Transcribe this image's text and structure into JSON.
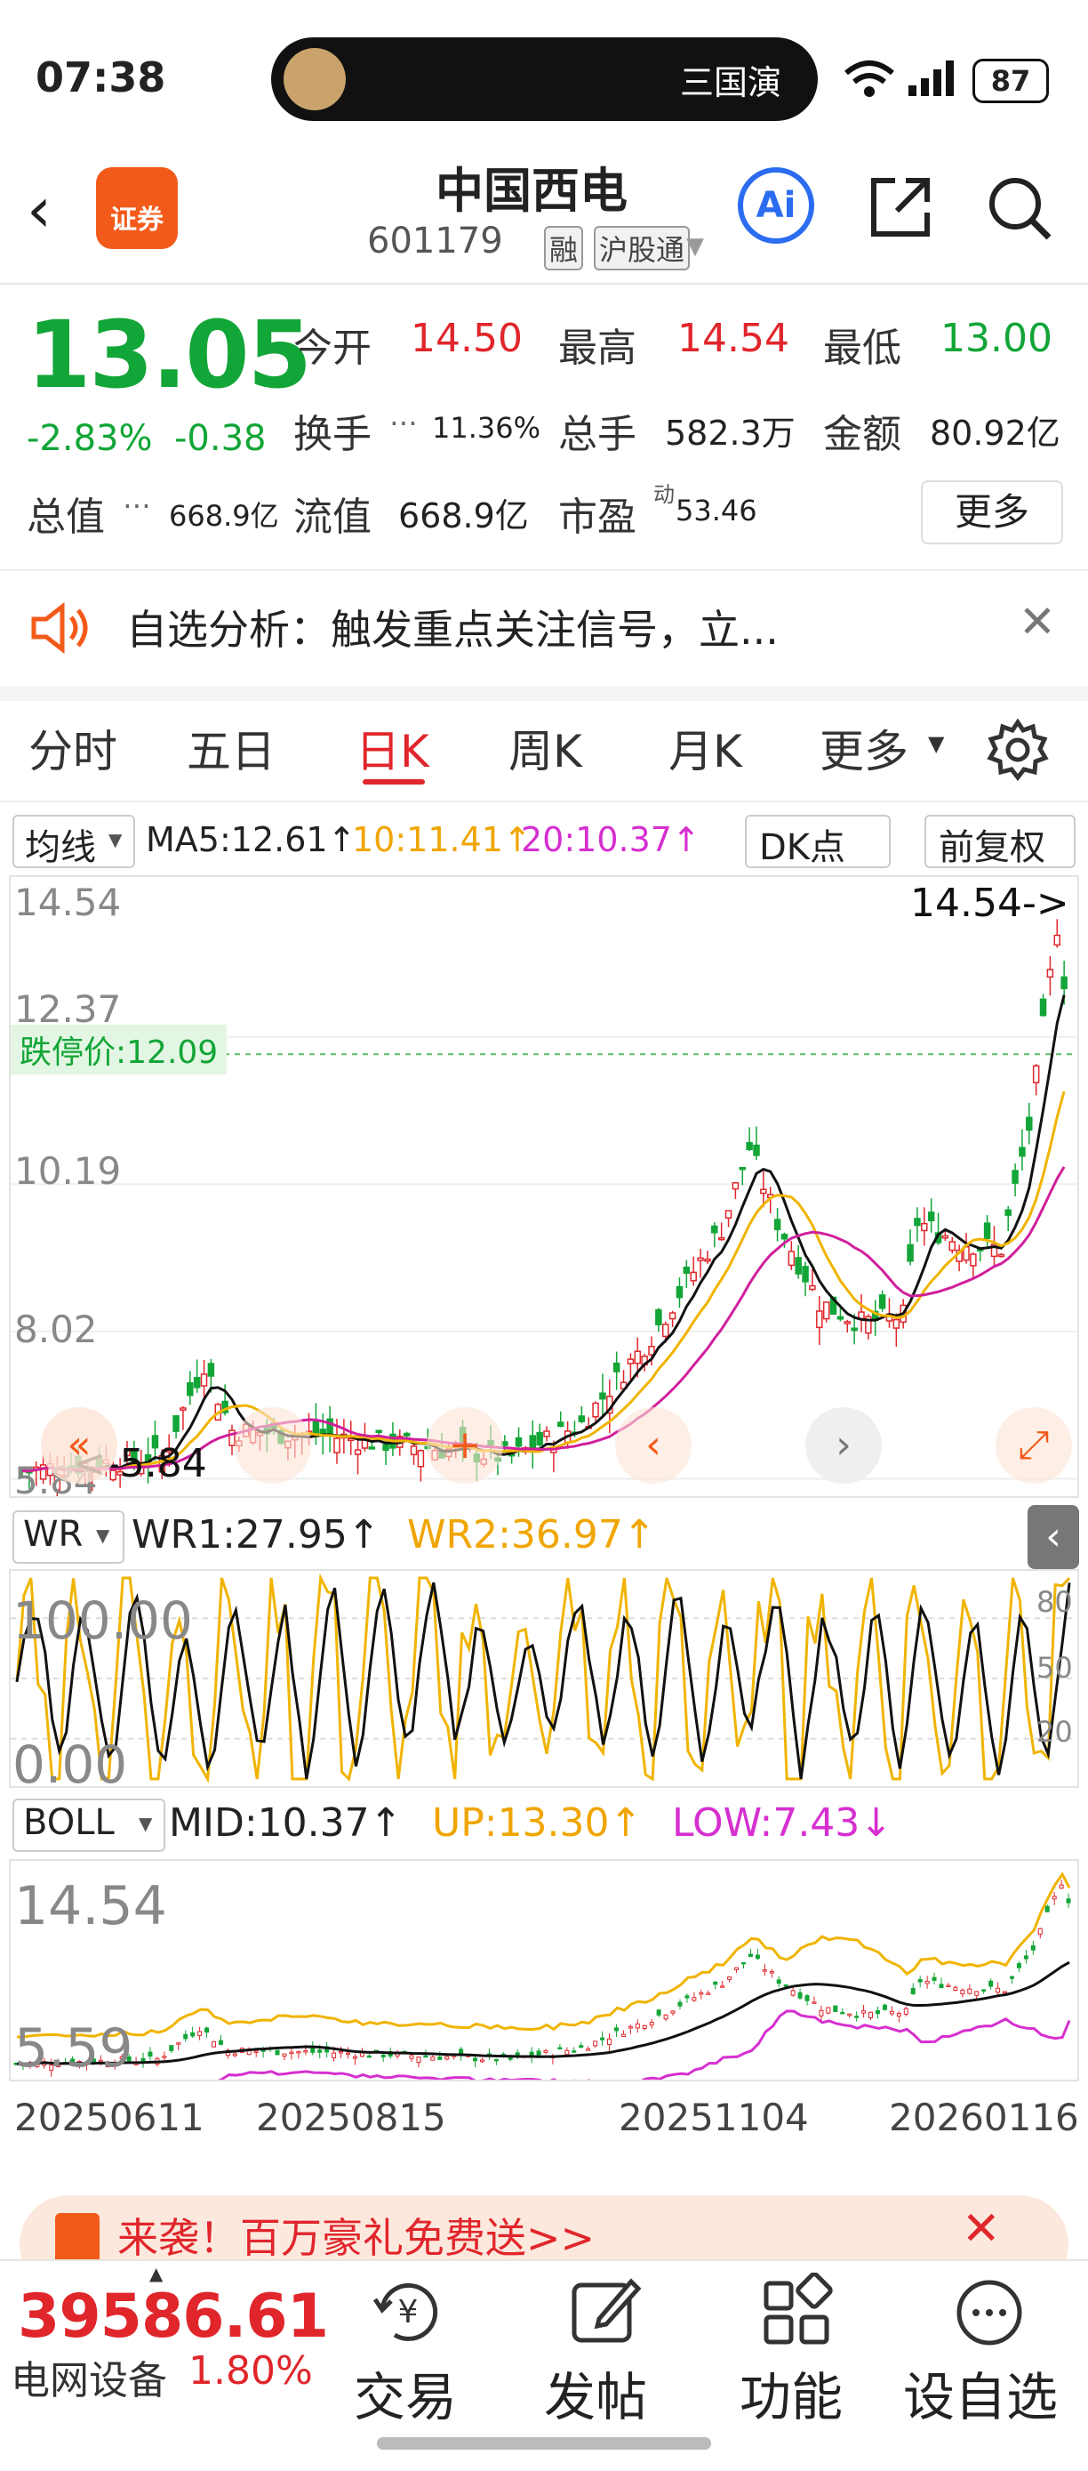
{
  "status_bar": {
    "time": "07:38",
    "island_text": "三国演",
    "battery": "87"
  },
  "header": {
    "logo_text": "证券",
    "stock_name": "中国西电",
    "stock_code": "601179",
    "tag_margin": "融",
    "tag_market": "沪股通",
    "ai_label": "Ai"
  },
  "quote": {
    "price": "13.05",
    "change_pct": "-2.83%",
    "change": "-0.38",
    "open_label": "今开",
    "open": "14.50",
    "high_label": "最高",
    "high": "14.54",
    "low_label": "最低",
    "low": "13.00",
    "turnover_label": "换手",
    "turnover": "11.36%",
    "volume_label": "总手",
    "volume": "582.3万",
    "amount_label": "金额",
    "amount": "80.92亿",
    "mktcap_label": "总值",
    "mktcap": "668.9亿",
    "float_label": "流值",
    "float": "668.9亿",
    "pe_label": "市盈",
    "pe_sup": "动",
    "pe": "53.46",
    "more_label": "更多"
  },
  "alert": {
    "text": "自选分析：触发重点关注信号，立..."
  },
  "tabs": [
    "分时",
    "五日",
    "日K",
    "周K",
    "月K",
    "更多"
  ],
  "active_tab": "日K",
  "indicators": {
    "ma_select": "均线",
    "ma5": "MA5:12.61↑",
    "ma10": "10:11.41↑",
    "ma20": "20:10.37↑",
    "dk_label": "DK点",
    "adjust_label": "前复权"
  },
  "kline": {
    "y_labels": [
      "14.54",
      "12.37",
      "10.19",
      "8.02",
      "5.84"
    ],
    "limit_down": "跌停价:12.09",
    "high_mark": "14.54->",
    "low_mark": "<-5.84",
    "colors": {
      "up": "#e0262b",
      "down": "#12a537",
      "ma5": "#111111",
      "ma10": "#f0b400",
      "ma20": "#d01f9c"
    }
  },
  "wr": {
    "select": "WR",
    "wr1": "WR1:27.95↑",
    "wr2": "WR2:36.97↑",
    "y_left": [
      "100.00",
      "0.00"
    ],
    "y_right": [
      "80",
      "50",
      "20"
    ]
  },
  "boll": {
    "select": "BOLL",
    "mid": "MID:10.37↑",
    "up": "UP:13.30↑",
    "low": "LOW:7.43↓",
    "y_labels": [
      "14.54",
      "5.59"
    ]
  },
  "dates": [
    "20250611",
    "20250815",
    "20251104",
    "20260116"
  ],
  "banner": {
    "text": "来袭！百万豪礼免费送>>"
  },
  "bottom": {
    "index_value": "39586.61",
    "index_name": "电网设备",
    "index_pct": "1.80%",
    "actions": [
      "交易",
      "发帖",
      "功能",
      "设自选"
    ]
  }
}
